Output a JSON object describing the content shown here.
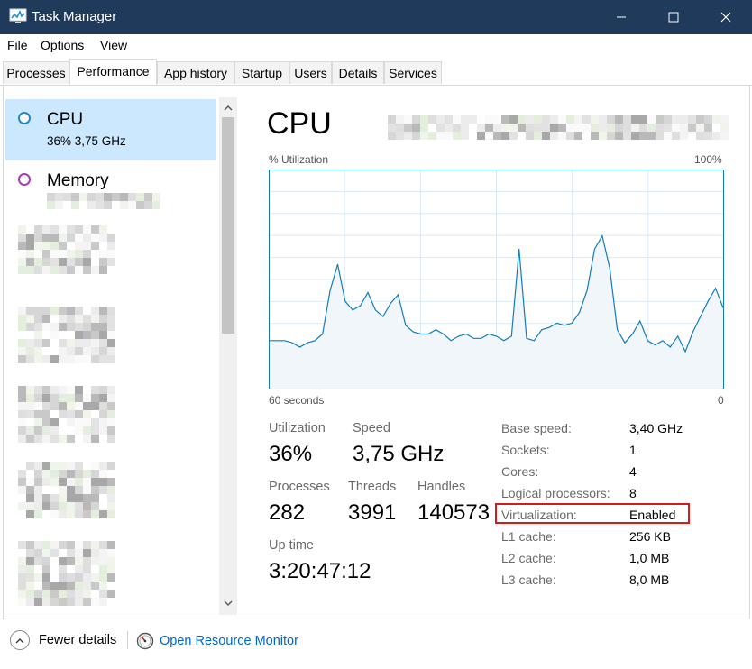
{
  "window": {
    "title": "Task Manager",
    "icons": {
      "app": "task-manager-icon",
      "minimize": "minimize-icon",
      "maximize": "maximize-icon",
      "close": "close-icon"
    }
  },
  "menu": [
    "File",
    "Options",
    "View"
  ],
  "tabs": [
    "Processes",
    "Performance",
    "App history",
    "Startup",
    "Users",
    "Details",
    "Services"
  ],
  "active_tab": "Performance",
  "sidebar": {
    "items": [
      {
        "title": "CPU",
        "subtitle": "36%  3,75 GHz",
        "selected": true,
        "color": "#1a8ac8"
      },
      {
        "title": "Memory",
        "subtitle": "",
        "selected": false,
        "color": "#a83cb8"
      }
    ]
  },
  "main": {
    "title": "CPU",
    "graph": {
      "y_label": "% Utilization",
      "y_max_label": "100%",
      "x_left_label": "60 seconds",
      "x_right_label": "0",
      "line_color": "#117dbb",
      "fill_color": "#f1f6fa",
      "grid_color": "#d9eaf4"
    },
    "stats": {
      "utilization": {
        "label": "Utilization",
        "value": "36%"
      },
      "speed": {
        "label": "Speed",
        "value": "3,75 GHz"
      },
      "processes": {
        "label": "Processes",
        "value": "282"
      },
      "threads": {
        "label": "Threads",
        "value": "3991"
      },
      "handles": {
        "label": "Handles",
        "value": "140573"
      },
      "uptime": {
        "label": "Up time",
        "value": "3:20:47:12"
      }
    },
    "info": [
      {
        "label": "Base speed:",
        "value": "3,40 GHz"
      },
      {
        "label": "Sockets:",
        "value": "1"
      },
      {
        "label": "Cores:",
        "value": "4"
      },
      {
        "label": "Logical processors:",
        "value": "8"
      },
      {
        "label": "Virtualization:",
        "value": "Enabled",
        "highlighted": true
      },
      {
        "label": "L1 cache:",
        "value": "256 KB"
      },
      {
        "label": "L2 cache:",
        "value": "1,0 MB"
      },
      {
        "label": "L3 cache:",
        "value": "8,0 MB"
      }
    ]
  },
  "footer": {
    "fewer_details": "Fewer details",
    "open_resource_monitor": "Open Resource Monitor"
  },
  "chart_data": {
    "type": "area",
    "title": "",
    "xlabel": "60 seconds",
    "ylabel": "% Utilization",
    "ylim": [
      0,
      100
    ],
    "xlim": [
      60,
      0
    ],
    "x": [
      60,
      59,
      58,
      57,
      56,
      55,
      54,
      53,
      52,
      51,
      50,
      49,
      48,
      47,
      46,
      45,
      44,
      43,
      42,
      41,
      40,
      39,
      38,
      37,
      36,
      35,
      34,
      33,
      32,
      31,
      30,
      29,
      28,
      27,
      26,
      25,
      24,
      23,
      22,
      21,
      20,
      19,
      18,
      17,
      16,
      15,
      14,
      13,
      12,
      11,
      10,
      9,
      8,
      7,
      6,
      5,
      4,
      3,
      2,
      1,
      0
    ],
    "values": [
      22,
      22,
      22,
      21,
      19,
      21,
      22,
      25,
      45,
      57,
      40,
      36,
      38,
      44,
      36,
      33,
      39,
      43,
      29,
      26,
      25,
      25,
      27,
      25,
      22,
      24,
      25,
      23,
      23,
      25,
      24,
      22,
      24,
      64,
      23,
      22,
      27,
      28,
      30,
      29,
      30,
      35,
      45,
      64,
      70,
      55,
      27,
      21,
      25,
      31,
      22,
      20,
      22,
      19,
      24,
      17,
      26,
      33,
      40,
      46,
      37
    ],
    "grid": true
  }
}
